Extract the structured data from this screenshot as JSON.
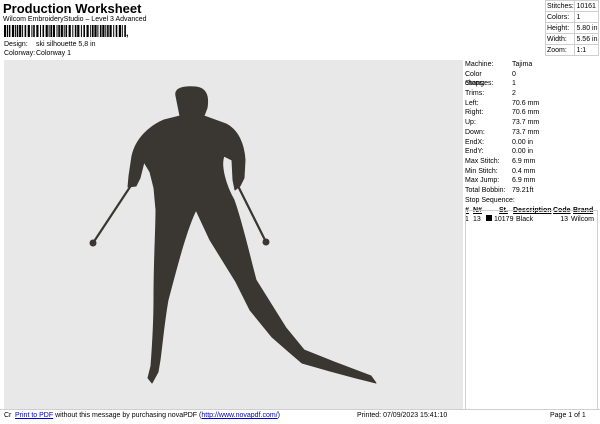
{
  "header": {
    "title": "Production Worksheet",
    "subtitle": "Wilcom EmbroideryStudio – Level 3 Advanced",
    "barcode_tail": ","
  },
  "meta": {
    "design_label": "Design:",
    "design_value": "ski silhouette 5,8 in",
    "colorway_label": "Colorway:",
    "colorway_value": "Colorway 1"
  },
  "top_stats": [
    {
      "label": "Stitches:",
      "value": "10161"
    },
    {
      "label": "Colors:",
      "value": "1"
    },
    {
      "label": "Height:",
      "value": "5.80 in"
    },
    {
      "label": "Width:",
      "value": "5.56 in"
    },
    {
      "label": "Zoom:",
      "value": "1:1"
    }
  ],
  "machine_info": [
    {
      "label": "Machine:",
      "value": "Tajima"
    },
    {
      "label": "Color changes:",
      "value": "0"
    },
    {
      "label": "Stops:",
      "value": "1"
    },
    {
      "label": "Trims:",
      "value": "2"
    },
    {
      "label": "Left:",
      "value": "70.6 mm"
    },
    {
      "label": "Right:",
      "value": "70.6 mm"
    },
    {
      "label": "Up:",
      "value": "73.7 mm"
    },
    {
      "label": "Down:",
      "value": "73.7 mm"
    },
    {
      "label": "EndX:",
      "value": "0.00 in"
    },
    {
      "label": "EndY:",
      "value": "0.00 in"
    },
    {
      "label": "Max Stitch:",
      "value": "6.9 mm"
    },
    {
      "label": "Min Stitch:",
      "value": "0.4 mm"
    },
    {
      "label": "Max Jump:",
      "value": "6.9 mm"
    },
    {
      "label": "Total Bobbin:",
      "value": "79.21ft"
    }
  ],
  "stop_sequence": {
    "label": "Stop Sequence:",
    "headers": [
      "#",
      "N#",
      "",
      "St.",
      "Description",
      "Code",
      "Brand"
    ],
    "rows": [
      {
        "num": "1",
        "n": "13",
        "st": "10179",
        "description": "Black",
        "code": "13",
        "brand": "Wilcom"
      }
    ]
  },
  "footer": {
    "prefix": "Cr",
    "link_label": "Print to PDF",
    "middle": " without this message by purchasing novaPDF (",
    "url": "http://www.novapdf.com/",
    "suffix": ")",
    "printed": "Printed: 07/09/2023 15:41:10",
    "page": "Page 1 of 1"
  },
  "colors": {
    "canvas_bg": "#e8e8e8",
    "thread": "#3a3631"
  }
}
